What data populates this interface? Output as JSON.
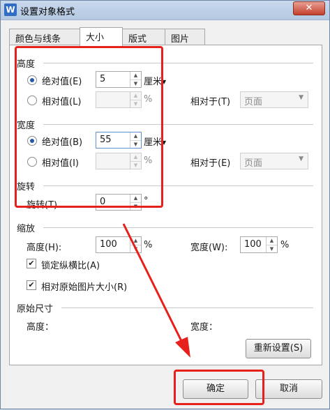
{
  "window": {
    "title": "设置对象格式",
    "app_icon": "W",
    "close": "✕"
  },
  "tabs": [
    {
      "label": "颜色与线条",
      "active": false
    },
    {
      "label": "大小",
      "active": true
    },
    {
      "label": "版式",
      "active": false
    },
    {
      "label": "图片",
      "active": false
    }
  ],
  "height_section": {
    "title": "高度",
    "absolute_label": "绝对值(E)",
    "absolute_value": "5",
    "absolute_unit": "厘米",
    "relative_label": "相对值(L)",
    "relative_value": "",
    "relative_unit": "%",
    "relative_to_label": "相对于(T)",
    "relative_to_value": "页面"
  },
  "width_section": {
    "title": "宽度",
    "absolute_label": "绝对值(B)",
    "absolute_value": "55",
    "absolute_unit": "厘米",
    "relative_label": "相对值(I)",
    "relative_value": "",
    "relative_unit": "%",
    "relative_to_label": "相对于(E)",
    "relative_to_value": "页面"
  },
  "rotation_section": {
    "title": "旋转",
    "rotation_label": "旋转(T)",
    "rotation_value": "0",
    "rotation_unit": "°"
  },
  "scale_section": {
    "title": "缩放",
    "height_label": "高度(H):",
    "height_value": "100",
    "height_unit": "%",
    "width_label": "宽度(W):",
    "width_value": "100",
    "width_unit": "%",
    "lock_ratio_label": "锁定纵横比(A)",
    "lock_ratio_checked": true,
    "relative_original_label": "相对原始图片大小(R)",
    "relative_original_checked": true
  },
  "original_size_section": {
    "title": "原始尺寸",
    "height_label": "高度：",
    "width_label": "宽度：",
    "reset_button": "重新设置(S)"
  },
  "footer": {
    "ok_button": "确定",
    "cancel_button": "取消"
  },
  "icons": {
    "spin_up": "▲",
    "spin_down": "▼",
    "dropdown": "▼",
    "check": "✔"
  },
  "colors": {
    "highlight": "#e6201b",
    "accent": "#2458a8"
  }
}
